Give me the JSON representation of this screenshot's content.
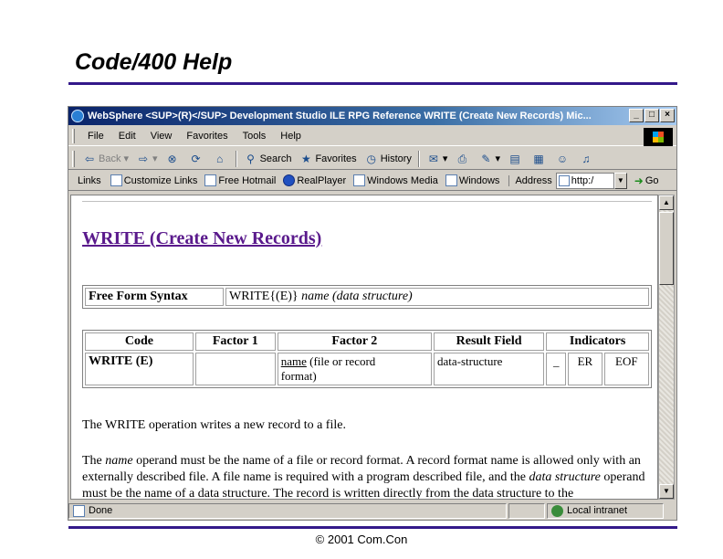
{
  "slide": {
    "title": "Code/400 Help",
    "footer": "© 2001 Com.Con"
  },
  "window": {
    "title": "WebSphere <SUP>(R)</SUP> Development Studio ILE RPG Reference   WRITE (Create New Records)   Mic...",
    "controls": {
      "minimize": "_",
      "maximize": "□",
      "close": "×"
    }
  },
  "menu": {
    "items": [
      "File",
      "Edit",
      "View",
      "Favorites",
      "Tools",
      "Help"
    ]
  },
  "toolbar": {
    "back": "Back",
    "search": "Search",
    "favorites": "Favorites",
    "history": "History"
  },
  "links": {
    "label": "Links",
    "items": [
      "Customize Links",
      "Free Hotmail",
      "RealPlayer",
      "Windows Media",
      "Windows"
    ],
    "address_label": "Address",
    "address_value": "http:/",
    "go": "Go"
  },
  "doc": {
    "heading": "WRITE (Create New Records)",
    "syntax": {
      "label": "Free Form Syntax",
      "prefix": "WRITE{(E)}",
      "name": "name",
      "data": "(data structure)"
    },
    "ops": {
      "headers": [
        "Code",
        "Factor 1",
        "Factor 2",
        "Result Field",
        "Indicators"
      ],
      "row": {
        "code": "WRITE (E)",
        "factor1": "",
        "factor2_name": "name",
        "factor2_rest": "(file or record",
        "factor2_line2": "format)",
        "result": "data-structure",
        "ind1": "_",
        "ind2": "ER",
        "ind3": "EOF"
      }
    },
    "p1": "The WRITE operation writes a new record to a file.",
    "p2": {
      "a": "The ",
      "name": "name",
      "b": " operand must be the name of a file or record format. A record format name is allowed only with an externally described file. A file name is required with a program described file, and the ",
      "ds": "data structure",
      "c": " operand must be the name of a data structure. The record is written directly from the data structure to the"
    }
  },
  "status": {
    "left": "Done",
    "zone": "Local intranet"
  }
}
